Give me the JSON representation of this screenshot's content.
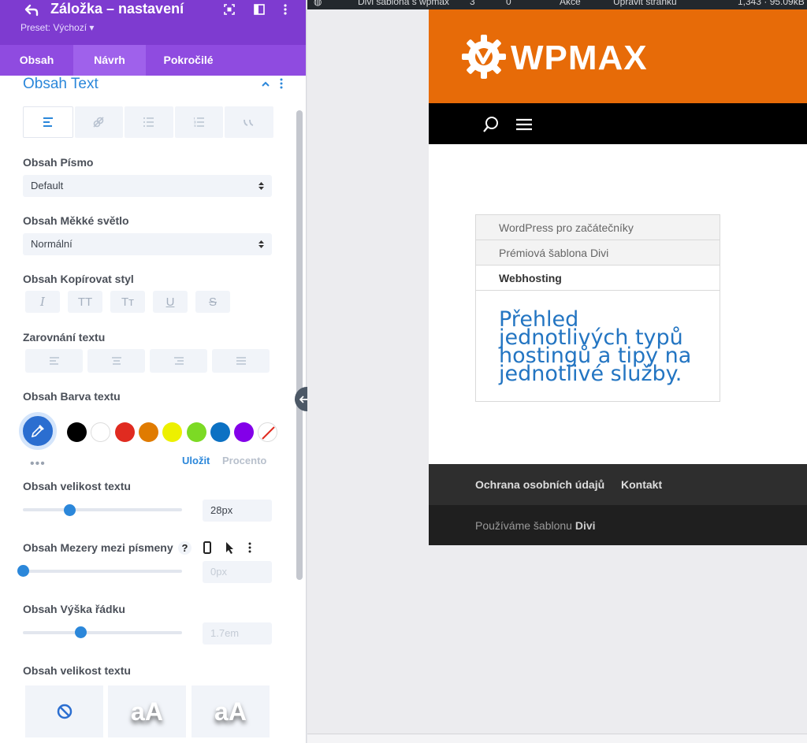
{
  "panel": {
    "title": "Záložka – nastavení",
    "preset": "Preset: Výchozí ▾",
    "tabs": [
      "Obsah",
      "Návrh",
      "Pokročilé"
    ],
    "active_tab": "Návrh"
  },
  "section": {
    "title": "Obsah Text",
    "subtab_icons": [
      "text-align-icon",
      "link-icon",
      "unordered-list-icon",
      "ordered-list-icon",
      "quote-icon"
    ]
  },
  "fields": {
    "font_label": "Obsah Písmo",
    "font_value": "Default",
    "weight_label": "Obsah Měkké světlo",
    "weight_value": "Normální",
    "style_label": "Obsah Kopírovat styl",
    "style_buttons": [
      "I",
      "TT",
      "Tт",
      "U",
      "S"
    ],
    "align_label": "Zarovnání textu",
    "color_label": "Obsah Barva textu",
    "color_selected": "#2b6ed0",
    "swatches": [
      "#000000",
      "#ffffff",
      "#e02b20",
      "#e07b00",
      "#edf000",
      "#7cda24",
      "#0c71c3",
      "#8300e9"
    ],
    "save_link": "Uložit",
    "percent_link": "Procento",
    "size_label": "Obsah velikost textu",
    "size_value": "28px",
    "size_level": 0.29,
    "spacing_label": "Obsah Mezery mezi písmeny",
    "spacing_placeholder": "0px",
    "spacing_level": 0.0,
    "lineheight_label": "Obsah Výška řádku",
    "lineheight_placeholder": "1.7em",
    "lineheight_level": 0.36,
    "shadow_label": "Obsah velikost textu",
    "shadow_sample": "aA"
  },
  "adminbar": {
    "items": [
      "Divi šablona s wpmax",
      "3",
      "0",
      "Akce",
      "Upravit stránku",
      "1,343 · 95.09kB"
    ]
  },
  "site": {
    "logo": "WPMAX",
    "tab_titles": [
      "WordPress pro začátečníky",
      "Prémiová šablona Divi",
      "Webhosting"
    ],
    "active_tab_index": 2,
    "tab_content": "Přehled jednotlivých typů hostingů a tipy na jednotlivé služby.",
    "footer_links": [
      "Ochrana osobních údajů",
      "Kontakt"
    ],
    "credit_text": "Používáme šablonu ",
    "credit_bold": "Divi"
  }
}
